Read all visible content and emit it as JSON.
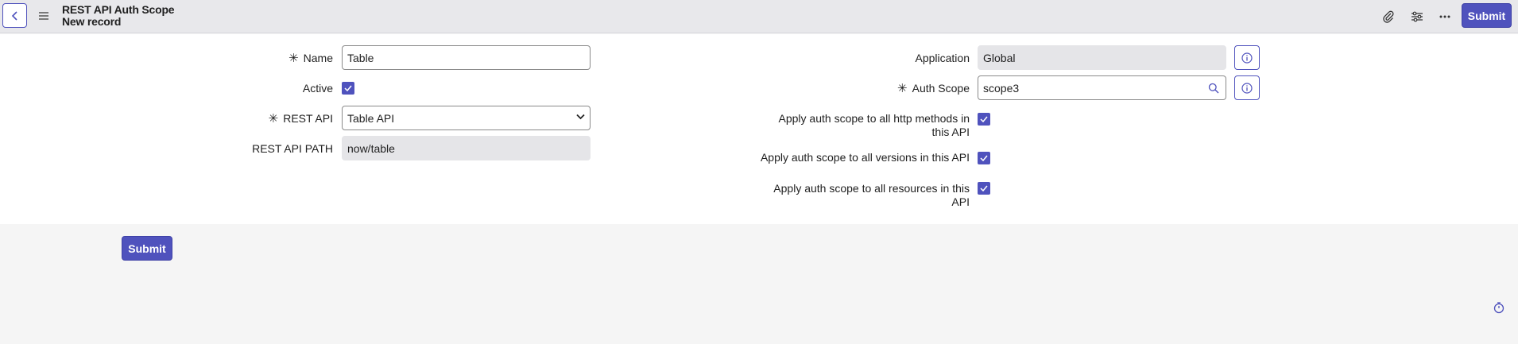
{
  "header": {
    "title": "REST API Auth Scope",
    "subtitle": "New record",
    "submit_label": "Submit",
    "icons": [
      "back-icon",
      "menu-icon",
      "attachment-icon",
      "settings-sliders-icon",
      "more-icon"
    ]
  },
  "form": {
    "left": {
      "name": {
        "label": "Name",
        "value": "Table",
        "required": true
      },
      "active": {
        "label": "Active",
        "checked": true
      },
      "rest_api": {
        "label": "REST API",
        "value": "Table API",
        "required": true
      },
      "rest_api_path": {
        "label": "REST API PATH",
        "value": "now/table"
      }
    },
    "right": {
      "application": {
        "label": "Application",
        "value": "Global"
      },
      "auth_scope": {
        "label": "Auth Scope",
        "value": "scope3",
        "required": true
      },
      "apply_http_methods": {
        "label_line1": "Apply auth scope to all http methods in",
        "label_line2": "this API",
        "checked": true
      },
      "apply_versions": {
        "label": "Apply auth scope to all versions in this API",
        "checked": true
      },
      "apply_resources": {
        "label_line1": "Apply auth scope to all resources in this",
        "label_line2": "API",
        "checked": true
      }
    },
    "required_marker": "✳"
  },
  "footer": {
    "submit_label": "Submit"
  },
  "colors": {
    "accent": "#4f52bd",
    "header_bg": "#e8e8eb",
    "readonly_bg": "#e5e5e8"
  }
}
